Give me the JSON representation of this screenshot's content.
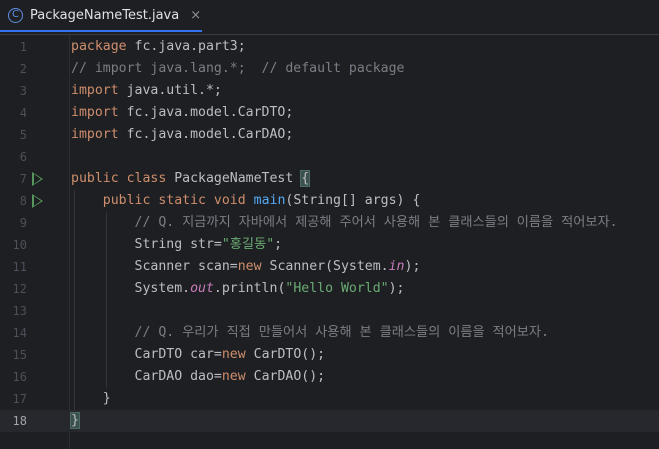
{
  "tab": {
    "icon": "C",
    "title": "PackageNameTest.java",
    "close": "×"
  },
  "current_line": 18,
  "run_icon_lines": [
    7,
    8
  ],
  "colors": {
    "keyword": "#cf8e6d",
    "comment": "#7a7e85",
    "string": "#6aab73",
    "method": "#56a8f5",
    "static_field": "#c77dbb",
    "plain": "#bcbec4",
    "run_gutter": "#57965c",
    "tab_underline": "#3574f0"
  },
  "lines": [
    {
      "num": "1",
      "tokens": [
        {
          "t": "kw",
          "v": "package"
        },
        {
          "t": "plain",
          "v": " fc.java.part3;"
        }
      ]
    },
    {
      "num": "2",
      "tokens": [
        {
          "t": "cm",
          "v": "// import java.lang.*;  // default package"
        }
      ]
    },
    {
      "num": "3",
      "tokens": [
        {
          "t": "kw",
          "v": "import"
        },
        {
          "t": "plain",
          "v": " java.util.*;"
        }
      ]
    },
    {
      "num": "4",
      "tokens": [
        {
          "t": "kw",
          "v": "import"
        },
        {
          "t": "plain",
          "v": " fc.java.model.CarDTO;"
        }
      ]
    },
    {
      "num": "5",
      "tokens": [
        {
          "t": "kw",
          "v": "import"
        },
        {
          "t": "plain",
          "v": " fc.java.model.CarDAO;"
        }
      ]
    },
    {
      "num": "6",
      "tokens": []
    },
    {
      "num": "7",
      "tokens": [
        {
          "t": "kw",
          "v": "public class"
        },
        {
          "t": "plain",
          "v": " PackageNameTest "
        },
        {
          "t": "brace",
          "v": "{"
        }
      ]
    },
    {
      "num": "8",
      "tokens": [
        {
          "t": "plain",
          "v": "    "
        },
        {
          "t": "kw",
          "v": "public static void"
        },
        {
          "t": "plain",
          "v": " "
        },
        {
          "t": "fn",
          "v": "main"
        },
        {
          "t": "plain",
          "v": "(String[] args) {"
        }
      ]
    },
    {
      "num": "9",
      "tokens": [
        {
          "t": "plain",
          "v": "        "
        },
        {
          "t": "cm",
          "v": "// Q. 지금까지 자바에서 제공해 주어서 사용해 본 클래스들의 이름을 적어보자."
        }
      ]
    },
    {
      "num": "10",
      "tokens": [
        {
          "t": "plain",
          "v": "        String str="
        },
        {
          "t": "str",
          "v": "\"홍길동\""
        },
        {
          "t": "plain",
          "v": ";"
        }
      ]
    },
    {
      "num": "11",
      "tokens": [
        {
          "t": "plain",
          "v": "        Scanner scan="
        },
        {
          "t": "kw",
          "v": "new"
        },
        {
          "t": "plain",
          "v": " Scanner(System."
        },
        {
          "t": "field",
          "v": "in"
        },
        {
          "t": "plain",
          "v": ");"
        }
      ]
    },
    {
      "num": "12",
      "tokens": [
        {
          "t": "plain",
          "v": "        System."
        },
        {
          "t": "field",
          "v": "out"
        },
        {
          "t": "plain",
          "v": ".println("
        },
        {
          "t": "str",
          "v": "\"Hello World\""
        },
        {
          "t": "plain",
          "v": ");"
        }
      ]
    },
    {
      "num": "13",
      "tokens": []
    },
    {
      "num": "14",
      "tokens": [
        {
          "t": "plain",
          "v": "        "
        },
        {
          "t": "cm",
          "v": "// Q. 우리가 직접 만들어서 사용해 본 클래스들의 이름을 적어보자."
        }
      ]
    },
    {
      "num": "15",
      "tokens": [
        {
          "t": "plain",
          "v": "        CarDTO car="
        },
        {
          "t": "kw",
          "v": "new"
        },
        {
          "t": "plain",
          "v": " CarDTO();"
        }
      ]
    },
    {
      "num": "16",
      "tokens": [
        {
          "t": "plain",
          "v": "        CarDAO dao="
        },
        {
          "t": "kw",
          "v": "new"
        },
        {
          "t": "plain",
          "v": " CarDAO();"
        }
      ]
    },
    {
      "num": "17",
      "tokens": [
        {
          "t": "plain",
          "v": "    }"
        }
      ]
    },
    {
      "num": "18",
      "tokens": [
        {
          "t": "brace",
          "v": "}"
        }
      ]
    }
  ]
}
